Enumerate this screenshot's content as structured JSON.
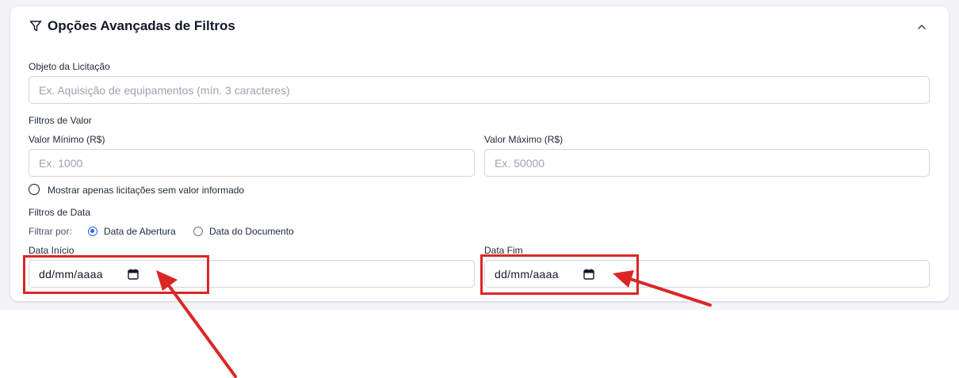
{
  "panel": {
    "title": "Opções Avançadas de Filtros",
    "filter_icon": "filter-funnel-icon",
    "collapse_icon": "chevron-up-icon"
  },
  "object": {
    "label": "Objeto da Licitação",
    "placeholder": "Ex. Aquisição de equipamentos (mín. 3 caracteres)"
  },
  "value_filters": {
    "section_label": "Filtros de Valor",
    "min_label": "Valor Mínimo (R$)",
    "min_placeholder": "Ex. 1000",
    "max_label": "Valor Máximo (R$)",
    "max_placeholder": "Ex. 50000",
    "no_value_option": "Mostrar apenas licitações sem valor informado",
    "no_value_checked": false
  },
  "date_filters": {
    "section_label": "Filtros de Data",
    "filter_by_label": "Filtrar por:",
    "options": [
      {
        "label": "Data de Abertura",
        "checked": true
      },
      {
        "label": "Data do Documento",
        "checked": false
      }
    ],
    "start_label": "Data Início",
    "start_value": "dd/mm/aaaa",
    "end_label": "Data Fim",
    "end_value": "dd/mm/aaaa",
    "calendar_icon": "calendar-icon"
  },
  "annotations": {
    "color": "#dc2626",
    "description_marks": [
      "red-highlight-box",
      "red-arrow"
    ]
  },
  "colors": {
    "accent": "#2563eb",
    "border": "#d1d5db",
    "placeholder": "#9ca3af",
    "page_bg": "#f3f4f8"
  }
}
